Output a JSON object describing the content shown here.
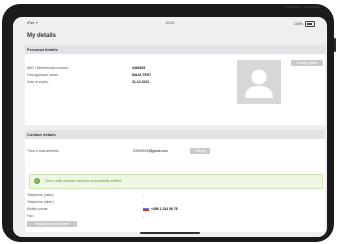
{
  "statusbar": {
    "left": "iPad ᯤ",
    "time": "10:10",
    "battery": "100%"
  },
  "page": {
    "title": "My details"
  },
  "personal": {
    "header": "Personal details",
    "fields": [
      {
        "label": "ABC / Membership number:",
        "value": "3462935"
      },
      {
        "label": "First applicant name:",
        "value": "MAJA TEST"
      },
      {
        "label": "Date of expiry:",
        "value": "31-12-2021"
      }
    ],
    "change_photo_label": "Change photo"
  },
  "contact": {
    "header": "Contact details",
    "email_label": "*Your e-mail address:",
    "email_value": "XXXXXXX@gmail.com",
    "email_change_label": "Change",
    "success_message": "Your e-mail address has been successfully verified.",
    "rows": [
      {
        "label": "Telephone (main):",
        "value": "-"
      },
      {
        "label": "Telephone (other):",
        "value": "-"
      },
      {
        "label": "Mobile phone:",
        "value": "+386 1 234 56 78"
      },
      {
        "label": "Fax:",
        "value": "-"
      }
    ],
    "change_numbers_label": "Change phone numbers"
  },
  "colors": {
    "success": "#6fa84a",
    "button": "#c8c9cc",
    "header_bg": "#e2e3e6"
  },
  "icons": {
    "success": "check-circle-icon",
    "avatar": "person-silhouette-icon",
    "flag": "slovenia-flag-icon"
  }
}
